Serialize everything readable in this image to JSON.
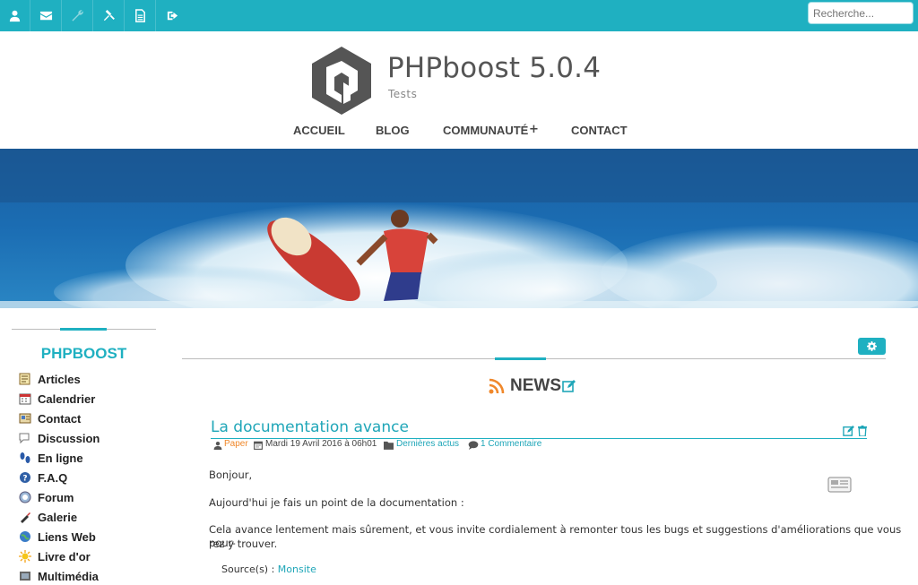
{
  "toolbar": {
    "icons": [
      "user-icon",
      "envelope-icon",
      "wrench-icon",
      "gavel-icon",
      "document-icon",
      "logout-icon"
    ],
    "search_placeholder": "Recherche...",
    "color": "#1fb0c1"
  },
  "header": {
    "title": "PHPboost 5.0.4",
    "subtitle": "Tests"
  },
  "nav": {
    "items": [
      "ACCUEIL",
      "BLOG",
      "COMMUNAUTÉ",
      "CONTACT"
    ],
    "expand_symbol": "+"
  },
  "sidebar": {
    "title": "PHPBOOST",
    "items": [
      {
        "label": "Articles",
        "icon": "article-icon"
      },
      {
        "label": "Calendrier",
        "icon": "calendar-icon"
      },
      {
        "label": "Contact",
        "icon": "contact-icon"
      },
      {
        "label": "Discussion",
        "icon": "discussion-icon"
      },
      {
        "label": "En ligne",
        "icon": "online-icon"
      },
      {
        "label": "F.A.Q",
        "icon": "faq-icon"
      },
      {
        "label": "Forum",
        "icon": "forum-icon"
      },
      {
        "label": "Galerie",
        "icon": "gallery-icon"
      },
      {
        "label": "Liens Web",
        "icon": "web-links-icon"
      },
      {
        "label": "Livre d'or",
        "icon": "guestbook-icon"
      },
      {
        "label": "Multimédia",
        "icon": "multimedia-icon"
      }
    ]
  },
  "content": {
    "section_title": "NEWS",
    "article": {
      "title": "La documentation avance",
      "author": "Paper",
      "date": "Mardi 19 Avril 2016 à 06h01",
      "category": "Dernières actus",
      "comments": "1 Commentaire",
      "paragraphs": [
        "Bonjour,",
        "Aujourd'hui je fais un point de la documentation :",
        "Cela avance lentement mais sûrement, et vous invite cordialement à remonter tous les bugs et suggestions d'améliorations que vous pour-",
        "rez y trouver."
      ],
      "source_label": "Source(s) :",
      "source_link": "Monsite"
    }
  }
}
